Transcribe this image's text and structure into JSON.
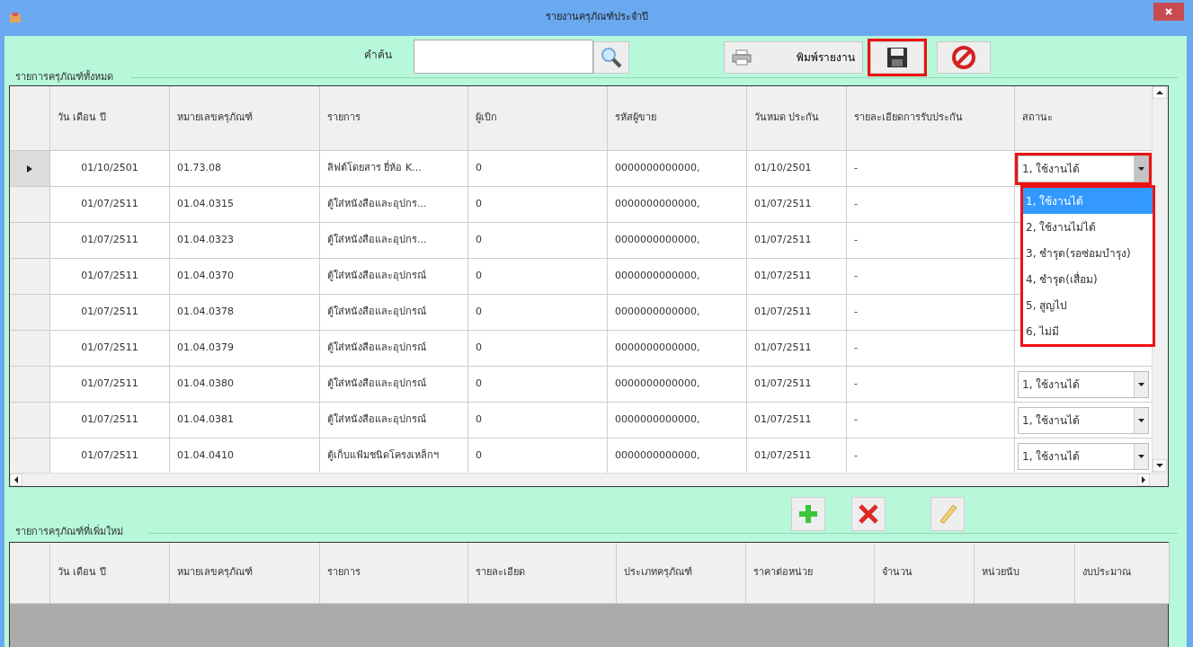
{
  "window": {
    "title": "รายงานครุภัณฑ์ประจำปี"
  },
  "toolbar": {
    "search_label": "คำค้น",
    "print_label": "พิมพ์รายงาน",
    "save_highlighted": true
  },
  "all_items": {
    "title": "รายการครุภัณฑ์ทั้งหมด",
    "columns": [
      "วัน เดือน ปี",
      "หมายเลขครุภัณฑ์",
      "รายการ",
      "ผู้เบิก",
      "รหัสผู้ขาย",
      "วันหมด ประกัน",
      "รายละเอียดการรับประกัน",
      "สถานะ"
    ],
    "rows": [
      {
        "current": true,
        "cells": [
          "01/10/2501",
          "01.73.08",
          "ลิฟต์โดยสาร ยี่ห้อ K...",
          "0",
          "0000000000000,",
          "01/10/2501",
          "-"
        ],
        "status": {
          "value": "1, ใช้งานได้",
          "expanded": true,
          "highlighted": true,
          "options": [
            {
              "label": "1, ใช้งานได้",
              "selected": true
            },
            {
              "label": "2, ใช้งานไม่ได้",
              "selected": false
            },
            {
              "label": "3, ชำรุด(รอซ่อมบำรุง)",
              "selected": false
            },
            {
              "label": "4, ชำรุด(เสื่อม)",
              "selected": false
            },
            {
              "label": "5, สูญไป",
              "selected": false
            },
            {
              "label": "6, ไม่มี",
              "selected": false
            }
          ]
        }
      },
      {
        "current": false,
        "cells": [
          "01/07/2511",
          "01.04.0315",
          "ตู้ใส่หนังสือและอุปกร...",
          "0",
          "0000000000000,",
          "01/07/2511",
          "-"
        ]
      },
      {
        "current": false,
        "cells": [
          "01/07/2511",
          "01.04.0323",
          "ตู้ใส่หนังสือและอุปกร...",
          "0",
          "0000000000000,",
          "01/07/2511",
          "-"
        ]
      },
      {
        "current": false,
        "cells": [
          "01/07/2511",
          "01.04.0370",
          "ตู้ใส่หนังสือและอุปกรณ์",
          "0",
          "0000000000000,",
          "01/07/2511",
          "-"
        ]
      },
      {
        "current": false,
        "cells": [
          "01/07/2511",
          "01.04.0378",
          "ตู้ใส่หนังสือและอุปกรณ์",
          "0",
          "0000000000000,",
          "01/07/2511",
          "-"
        ]
      },
      {
        "current": false,
        "cells": [
          "01/07/2511",
          "01.04.0379",
          "ตู้ใส่หนังสือและอุปกรณ์",
          "0",
          "0000000000000,",
          "01/07/2511",
          "-"
        ]
      },
      {
        "current": false,
        "cells": [
          "01/07/2511",
          "01.04.0380",
          "ตู้ใส่หนังสือและอุปกรณ์",
          "0",
          "0000000000000,",
          "01/07/2511",
          "-"
        ],
        "status": {
          "value": "1, ใช้งานได้",
          "expanded": false,
          "highlighted": false
        }
      },
      {
        "current": false,
        "cells": [
          "01/07/2511",
          "01.04.0381",
          "ตู้ใส่หนังสือและอุปกรณ์",
          "0",
          "0000000000000,",
          "01/07/2511",
          "-"
        ],
        "status": {
          "value": "1, ใช้งานได้",
          "expanded": false,
          "highlighted": false
        }
      },
      {
        "current": false,
        "cells": [
          "01/07/2511",
          "01.04.0410",
          "ตู้เก็บแฟ้มชนิดโครงเหล็กฯ",
          "0",
          "0000000000000,",
          "01/07/2511",
          "-"
        ],
        "status": {
          "value": "1, ใช้งานได้",
          "expanded": false,
          "highlighted": false
        }
      }
    ]
  },
  "actions": [
    {
      "kind": "add"
    },
    {
      "kind": "delete"
    },
    {
      "kind": "edit"
    }
  ],
  "new_items": {
    "title": "รายการครุภัณฑ์ที่เพิ่มใหม่",
    "columns": [
      "วัน เดือน ปี",
      "หมายเลขครุภัณฑ์",
      "รายการ",
      "รายละเอียด",
      "ประเภทครุภัณฑ์",
      "ราคาต่อหน่วย",
      "จำนวน",
      "หน่วยนับ",
      "งบประมาณ"
    ]
  }
}
